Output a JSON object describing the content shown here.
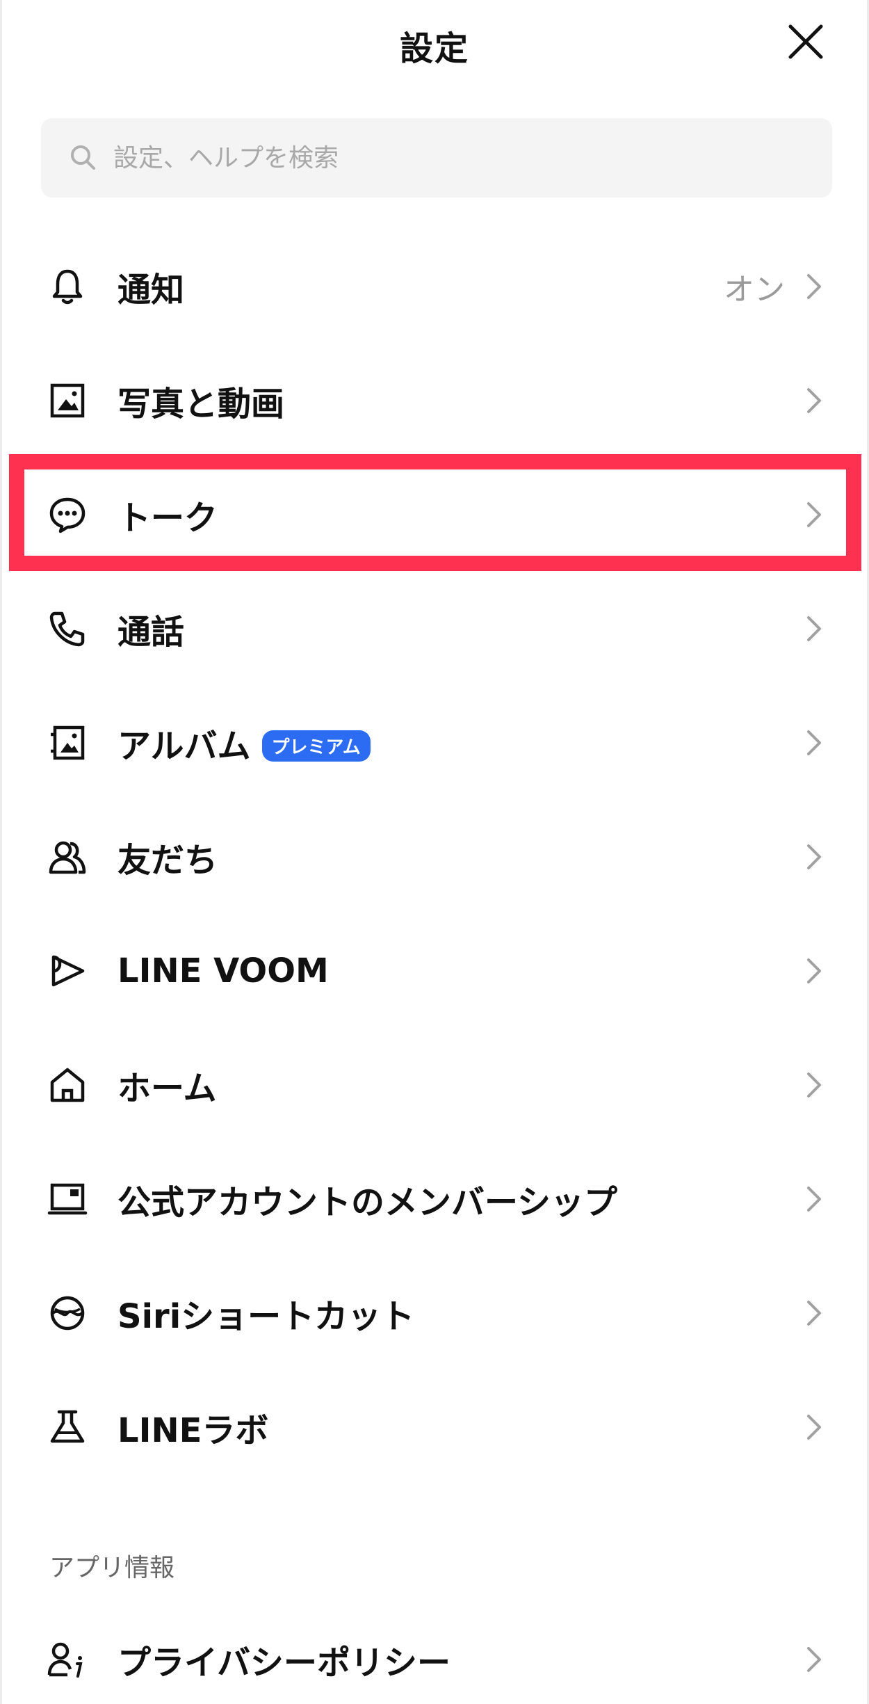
{
  "header": {
    "title": "設定"
  },
  "search": {
    "placeholder": "設定、ヘルプを検索"
  },
  "items": [
    {
      "label": "通知",
      "value": "オン",
      "icon": "bell-icon"
    },
    {
      "label": "写真と動画",
      "icon": "photo-icon"
    },
    {
      "label": "トーク",
      "icon": "chat-bubble-icon"
    },
    {
      "label": "通話",
      "icon": "phone-icon"
    },
    {
      "label": "アルバム",
      "badge": "プレミアム",
      "icon": "album-icon"
    },
    {
      "label": "友だち",
      "icon": "friends-icon"
    },
    {
      "label": "LINE VOOM",
      "icon": "voom-play-icon"
    },
    {
      "label": "ホーム",
      "icon": "home-icon"
    },
    {
      "label": "公式アカウントのメンバーシップ",
      "icon": "membership-card-icon"
    },
    {
      "label": "Siriショートカット",
      "icon": "siri-icon"
    },
    {
      "label": "LINEラボ",
      "icon": "flask-icon"
    }
  ],
  "sections": {
    "app_info": {
      "title": "アプリ情報",
      "items": [
        {
          "label": "プライバシーポリシー",
          "icon": "privacy-person-info-icon"
        }
      ]
    }
  },
  "colors": {
    "highlight": "#ff3150",
    "badge": "#2b6cf2",
    "search_bg": "#f4f4f4"
  }
}
